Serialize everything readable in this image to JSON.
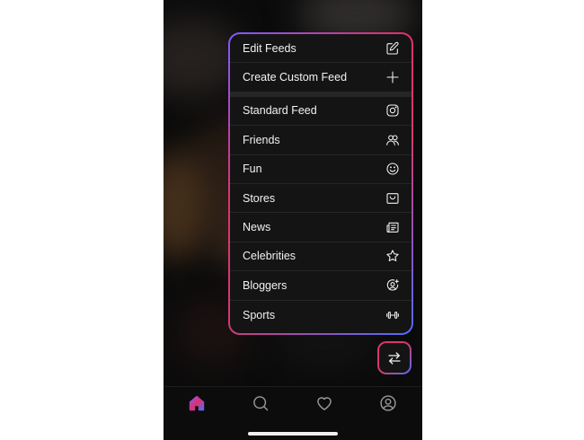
{
  "menu": {
    "top_items": [
      {
        "label": "Edit Feeds",
        "icon": "edit-icon"
      },
      {
        "label": "Create Custom Feed",
        "icon": "plus-icon"
      }
    ],
    "feed_items": [
      {
        "label": "Standard Feed",
        "icon": "instagram-icon"
      },
      {
        "label": "Friends",
        "icon": "friends-icon"
      },
      {
        "label": "Fun",
        "icon": "smile-icon"
      },
      {
        "label": "Stores",
        "icon": "store-icon"
      },
      {
        "label": "News",
        "icon": "newspaper-icon"
      },
      {
        "label": "Celebrities",
        "icon": "star-icon"
      },
      {
        "label": "Bloggers",
        "icon": "blogger-icon"
      },
      {
        "label": "Sports",
        "icon": "dumbbell-icon"
      }
    ]
  },
  "switch_button": {
    "icon": "swap-arrows-icon"
  },
  "tabbar": {
    "tabs": [
      {
        "name": "home",
        "icon": "home-icon",
        "active": true
      },
      {
        "name": "search",
        "icon": "search-icon",
        "active": false
      },
      {
        "name": "likes",
        "icon": "heart-icon",
        "active": false
      },
      {
        "name": "profile",
        "icon": "profile-icon",
        "active": false
      }
    ]
  },
  "colors": {
    "accent_pink": "#e0306e",
    "accent_blue": "#4f6bff",
    "accent_purple": "#7b5cff",
    "menu_background": "#141414",
    "text": "#f2f2f2"
  }
}
